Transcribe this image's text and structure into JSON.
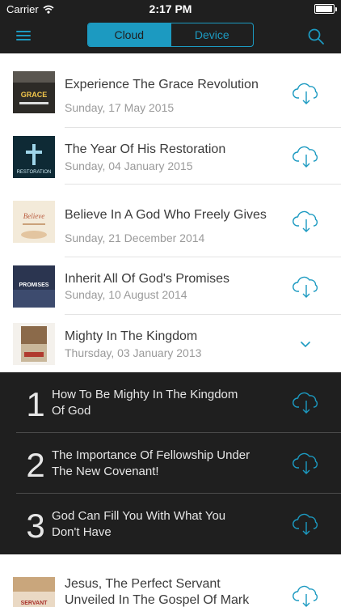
{
  "status": {
    "carrier": "Carrier",
    "time": "2:17 PM",
    "battery_level": 0.95
  },
  "nav": {
    "segments": [
      "Cloud",
      "Device"
    ],
    "selected": "Cloud"
  },
  "sermons": [
    {
      "title": "Experience The Grace Revolution",
      "date": "Sunday, 17 May 2015",
      "thumb_text": "GRACE"
    },
    {
      "title": "The Year Of His Restoration",
      "date": "Sunday, 04 January 2015",
      "thumb_text": "RESTORATION"
    },
    {
      "title": "Believe In A God Who Freely Gives",
      "date": "Sunday, 21 December 2014",
      "thumb_text": "Believe"
    },
    {
      "title": "Inherit All Of God's Promises",
      "date": "Sunday, 10 August 2014",
      "thumb_text": "PROMISES"
    },
    {
      "title": "Mighty In The Kingdom",
      "date": "Thursday, 03 January 2013",
      "expanded": true,
      "parts": [
        {
          "number": "1",
          "title": "How To Be Mighty In The Kingdom Of God"
        },
        {
          "number": "2",
          "title": "The Importance Of Fellowship Under The New Covenant!"
        },
        {
          "number": "3",
          "title": "God Can Fill You With What You Don't Have"
        }
      ]
    },
    {
      "title": "Jesus, The Perfect Servant",
      "title2": "Unveiled In The Gospel Of Mark",
      "thumb_text": "SERVANT"
    }
  ],
  "colors": {
    "accent": "#1c9ac1",
    "bar": "#1f1f1f",
    "sub_bg": "#1f1f1f"
  }
}
